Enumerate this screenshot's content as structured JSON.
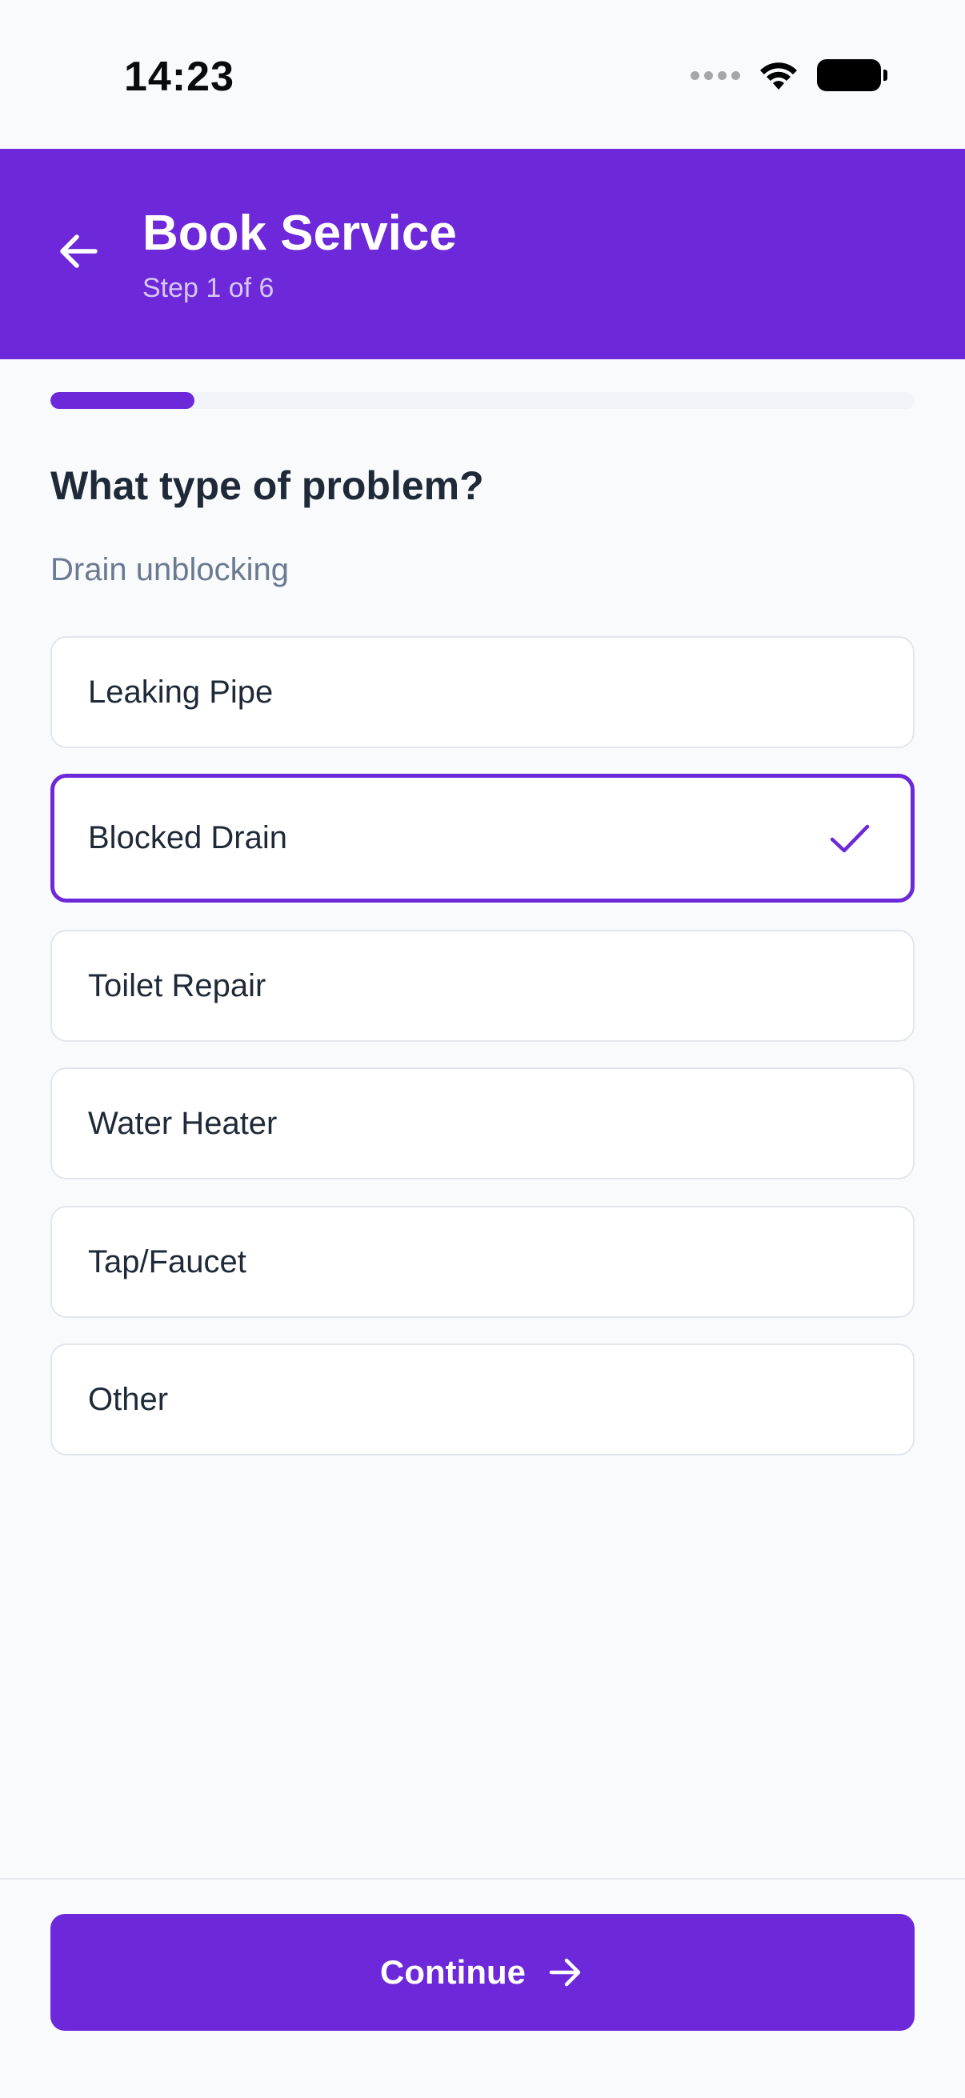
{
  "status_bar": {
    "time": "14:23"
  },
  "header": {
    "title": "Book Service",
    "subtitle": "Step 1 of 6",
    "back_icon": "arrow-left-icon"
  },
  "progress": {
    "fraction": 0.167
  },
  "question": {
    "title": "What type of problem?",
    "hint": "Drain unblocking"
  },
  "options": [
    {
      "label": "Leaking Pipe",
      "selected": false
    },
    {
      "label": "Blocked Drain",
      "selected": true
    },
    {
      "label": "Toilet Repair",
      "selected": false
    },
    {
      "label": "Water Heater",
      "selected": false
    },
    {
      "label": "Tap/Faucet",
      "selected": false
    },
    {
      "label": "Other",
      "selected": false
    }
  ],
  "footer": {
    "continue_label": "Continue",
    "continue_icon": "arrow-right-icon"
  },
  "colors": {
    "accent": "#6d28d9",
    "text": "#1f2937",
    "muted": "#6b7a90",
    "background": "#f8fafc"
  }
}
